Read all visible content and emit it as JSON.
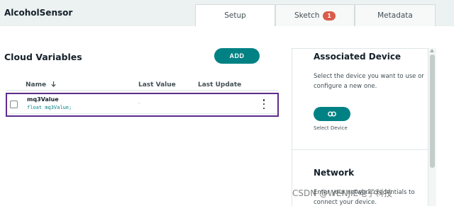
{
  "header": {
    "app_title": "AlcoholSensor",
    "tabs": [
      {
        "label": "Setup",
        "active": true
      },
      {
        "label": "Sketch",
        "badge": "1",
        "active": false
      },
      {
        "label": "Metadata",
        "active": false
      }
    ]
  },
  "variables": {
    "title": "Cloud Variables",
    "add_label": "ADD",
    "columns": {
      "name": "Name",
      "sort_icon": "arrow-down-icon",
      "last_value": "Last Value",
      "last_update": "Last Update"
    },
    "rows": [
      {
        "name": "mq3Value",
        "declaration": "float mq3Value;",
        "last_value": "-",
        "last_update": ""
      }
    ]
  },
  "associated_device": {
    "title": "Associated Device",
    "description": "Select the device you want to use or configure a new one.",
    "button_icon": "link-icon",
    "select_label": "Select Device"
  },
  "network": {
    "title": "Network",
    "description": "Enter your network credentials to connect your device."
  },
  "watermark": "CSDN @WENJIE电子科技",
  "colors": {
    "accent": "#008184",
    "badge": "#da5b4a",
    "selection": "#5b2d8c"
  }
}
